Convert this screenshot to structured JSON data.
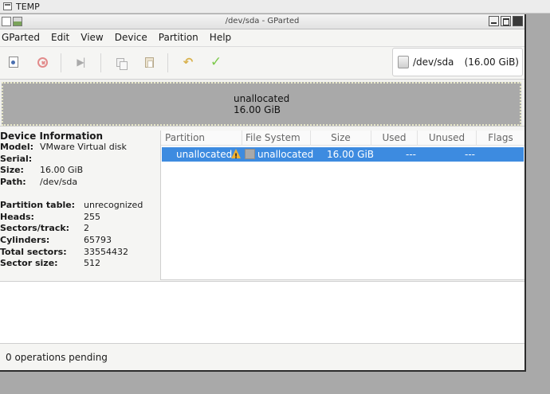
{
  "desktop": {
    "label": "TEMP"
  },
  "window": {
    "title": "/dev/sda - GParted"
  },
  "menu": {
    "items": [
      "GParted",
      "Edit",
      "View",
      "Device",
      "Partition",
      "Help"
    ]
  },
  "toolbar": {
    "icons": [
      "new-partition-icon",
      "delete-partition-icon",
      "resize-move-icon",
      "copy-icon",
      "paste-icon",
      "undo-icon",
      "apply-icon"
    ]
  },
  "device_selector": {
    "device": "/dev/sda",
    "size": "(16.00 GiB)"
  },
  "graph": {
    "label": "unallocated",
    "size": "16.00 GiB"
  },
  "device_info": {
    "heading": "Device Information",
    "rows": [
      {
        "key": "Model:",
        "value": "VMware Virtual disk"
      },
      {
        "key": "Serial:",
        "value": ""
      },
      {
        "key": "Size:",
        "value": "16.00 GiB"
      },
      {
        "key": "Path:",
        "value": "/dev/sda"
      }
    ],
    "rows2": [
      {
        "key": "Partition table:",
        "value": "unrecognized"
      },
      {
        "key": "Heads:",
        "value": "255"
      },
      {
        "key": "Sectors/track:",
        "value": "2"
      },
      {
        "key": "Cylinders:",
        "value": "65793"
      },
      {
        "key": "Total sectors:",
        "value": "33554432"
      },
      {
        "key": "Sector size:",
        "value": "512"
      }
    ]
  },
  "table": {
    "columns": [
      "Partition",
      "File System",
      "Size",
      "Used",
      "Unused",
      "Flags"
    ],
    "rows": [
      {
        "partition": "unallocated",
        "filesystem": "unallocated",
        "size": "16.00 GiB",
        "used": "---",
        "unused": "---",
        "flags": ""
      }
    ]
  },
  "colors": {
    "selection": "#3d8be0",
    "unallocated": "#a9a9a9"
  },
  "status": {
    "text": "0 operations pending"
  }
}
